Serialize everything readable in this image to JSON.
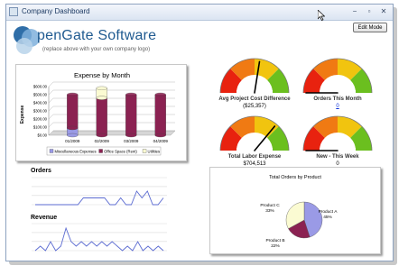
{
  "window": {
    "title": "Company Dashboard",
    "edit_mode_label": "Edit Mode"
  },
  "logo": {
    "text": "penGate Software",
    "subtitle": "(replace above with your own company logo)"
  },
  "expense_chart": {
    "title": "Expense by Month",
    "ylabel": "Expense",
    "y_ticks": [
      "$0.00",
      "$100.00",
      "$200.00",
      "$300.00",
      "$400.00",
      "$500.00",
      "$600.00"
    ],
    "legend": [
      "Miscellaneous Expenses",
      "Office Space (Rent)",
      "Utilities"
    ]
  },
  "gauges": [
    {
      "label": "Avg Project Cost Difference",
      "value": "($25,357)",
      "level": 0.55,
      "is_link": false
    },
    {
      "label": "Orders This Month",
      "value": "0",
      "level": 0.0,
      "is_link": true
    },
    {
      "label": "Total Labor Expense",
      "value": "$704,513",
      "level": 0.72,
      "is_link": false
    },
    {
      "label": "New - This Week",
      "value": "0",
      "level": 0.0,
      "is_link": false
    }
  ],
  "orders": {
    "label": "Orders"
  },
  "revenue": {
    "label": "Revenue"
  },
  "pie": {
    "title": "Total Orders by Product",
    "slices": [
      {
        "name": "Product A",
        "pct": "45%",
        "value": 45,
        "color": "#9a9ae6"
      },
      {
        "name": "Product B",
        "pct": "22%",
        "value": 22,
        "color": "#8b2252"
      },
      {
        "name": "Product C",
        "pct": "33%",
        "value": 33,
        "color": "#fbfbd2"
      }
    ]
  },
  "chart_data": [
    {
      "type": "bar",
      "title": "Expense by Month",
      "xlabel": "",
      "ylabel": "Expense",
      "categories": [
        "01/2009",
        "02/2009",
        "03/2009",
        "04/2009"
      ],
      "series": [
        {
          "name": "Miscellaneous Expenses",
          "values": [
            90,
            0,
            0,
            0
          ]
        },
        {
          "name": "Office Space (Rent)",
          "values": [
            410,
            460,
            500,
            500
          ]
        },
        {
          "name": "Utilities",
          "values": [
            0,
            120,
            0,
            0
          ]
        }
      ],
      "ylim": [
        0,
        600
      ],
      "legend": "bottom",
      "grid": true
    },
    {
      "type": "line",
      "title": "Orders",
      "series": [
        {
          "name": "",
          "values": [
            0,
            0,
            0,
            0,
            0,
            0,
            0,
            0,
            0,
            1,
            1,
            1,
            1,
            1,
            0,
            0,
            1,
            0,
            0,
            2,
            1,
            2,
            0,
            0,
            1
          ]
        }
      ],
      "ylim": [
        0,
        4
      ]
    },
    {
      "type": "line",
      "title": "Revenue",
      "series": [
        {
          "name": "",
          "values": [
            0,
            1,
            0,
            2,
            0,
            1,
            5,
            2,
            1,
            2,
            1,
            2,
            1,
            2,
            1,
            2,
            1,
            0,
            1,
            0,
            2,
            0,
            1,
            0,
            1,
            0
          ]
        }
      ],
      "ylim": [
        0,
        6
      ]
    },
    {
      "type": "pie",
      "title": "Total Orders by Product",
      "categories": [
        "Product A",
        "Product B",
        "Product C"
      ],
      "values": [
        45,
        22,
        33
      ]
    }
  ]
}
